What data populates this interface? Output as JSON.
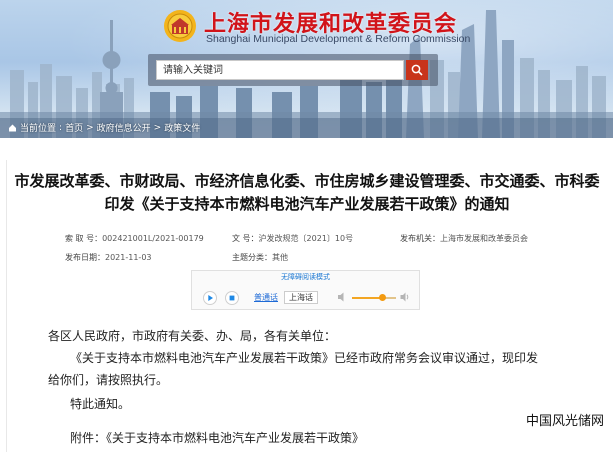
{
  "header": {
    "title_cn": "上海市发展和改革委员会",
    "title_en": "Shanghai Municipal Development & Reform Commission",
    "logo_icon": "government-emblem-icon",
    "accent_color": "#d1141a"
  },
  "search": {
    "placeholder": "请输入关键词",
    "button_icon": "search-icon",
    "button_color": "#c8341b"
  },
  "breadcrumb": [
    "当前位置",
    "首页",
    "政府信息公开",
    "政策文件"
  ],
  "article": {
    "title": "市发展改革委、市财政局、市经济信息化委、市住房城乡建设管理委、市交通委、市科委印发《关于支持本市燃料电池汽车产业发展若干政策》的通知",
    "meta": {
      "index_label": "索 取 号：",
      "index_value": "002421001L/2021-00179",
      "doc_label": "文 号：",
      "doc_value": "沪发改规范〔2021〕10号",
      "issuer_label": "发布机关：",
      "issuer_value": "上海市发展和改革委员会",
      "date_label": "发布日期：",
      "date_value": "2021-11-03",
      "category_label": "主题分类：",
      "category_value": "其他"
    },
    "player": {
      "notice": "无障碍阅读模式",
      "voice": "普通话",
      "language": "上海话",
      "volume": 0.7
    },
    "salutation": "各区人民政府，市政府有关委、办、局，各有关单位：",
    "paragraph_1a": "《关于支持本市燃料电池汽车产业发展若干政策》已经市政府常务会议审议通过，现印发",
    "paragraph_1b": "给你们，请按照执行。",
    "notice": "特此通知。",
    "attachment": "附件：《关于支持本市燃料电池汽车产业发展若干政策》"
  },
  "watermark": "中国风光储网"
}
